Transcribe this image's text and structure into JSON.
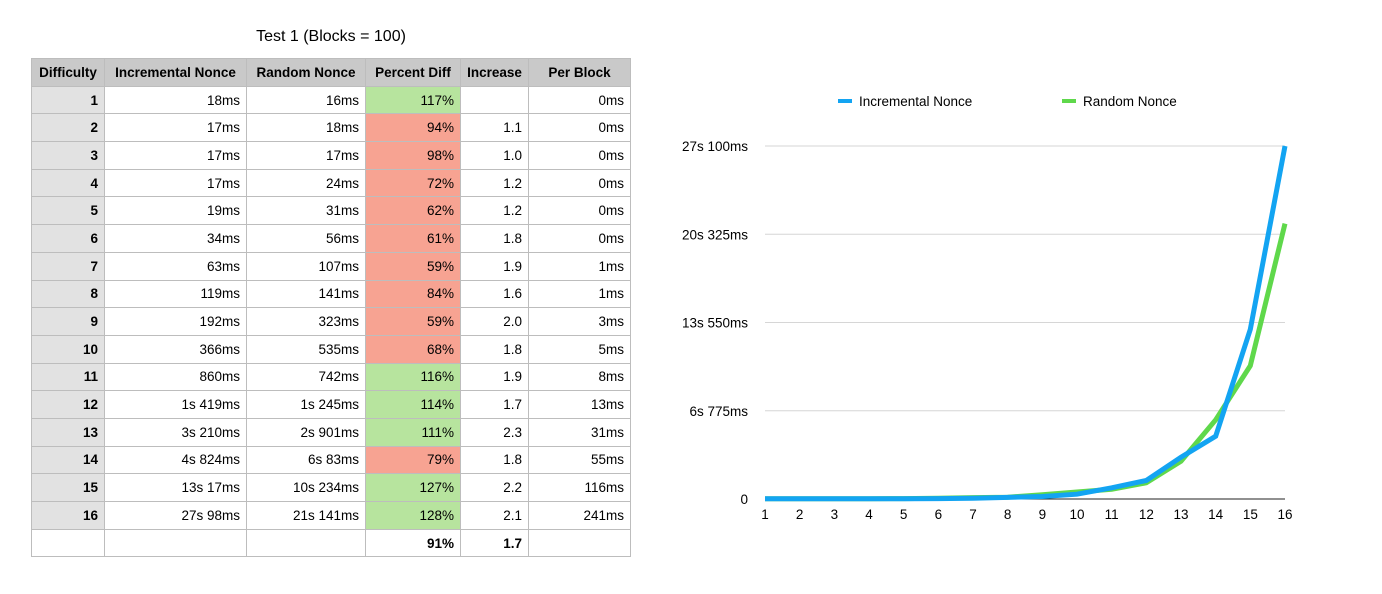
{
  "table": {
    "title": "Test 1 (Blocks = 100)",
    "headers": [
      "Difficulty",
      "Incremental Nonce",
      "Random Nonce",
      "Percent Diff",
      "Increase",
      "Per Block"
    ],
    "rows": [
      {
        "difficulty": "1",
        "incremental": "18ms",
        "random": "16ms",
        "percent": "117%",
        "status": "good",
        "increase": "",
        "per_block": "0ms"
      },
      {
        "difficulty": "2",
        "incremental": "17ms",
        "random": "18ms",
        "percent": "94%",
        "status": "bad",
        "increase": "1.1",
        "per_block": "0ms"
      },
      {
        "difficulty": "3",
        "incremental": "17ms",
        "random": "17ms",
        "percent": "98%",
        "status": "bad",
        "increase": "1.0",
        "per_block": "0ms"
      },
      {
        "difficulty": "4",
        "incremental": "17ms",
        "random": "24ms",
        "percent": "72%",
        "status": "bad",
        "increase": "1.2",
        "per_block": "0ms"
      },
      {
        "difficulty": "5",
        "incremental": "19ms",
        "random": "31ms",
        "percent": "62%",
        "status": "bad",
        "increase": "1.2",
        "per_block": "0ms"
      },
      {
        "difficulty": "6",
        "incremental": "34ms",
        "random": "56ms",
        "percent": "61%",
        "status": "bad",
        "increase": "1.8",
        "per_block": "0ms"
      },
      {
        "difficulty": "7",
        "incremental": "63ms",
        "random": "107ms",
        "percent": "59%",
        "status": "bad",
        "increase": "1.9",
        "per_block": "1ms"
      },
      {
        "difficulty": "8",
        "incremental": "119ms",
        "random": "141ms",
        "percent": "84%",
        "status": "bad",
        "increase": "1.6",
        "per_block": "1ms"
      },
      {
        "difficulty": "9",
        "incremental": "192ms",
        "random": "323ms",
        "percent": "59%",
        "status": "bad",
        "increase": "2.0",
        "per_block": "3ms"
      },
      {
        "difficulty": "10",
        "incremental": "366ms",
        "random": "535ms",
        "percent": "68%",
        "status": "bad",
        "increase": "1.8",
        "per_block": "5ms"
      },
      {
        "difficulty": "11",
        "incremental": "860ms",
        "random": "742ms",
        "percent": "116%",
        "status": "good",
        "increase": "1.9",
        "per_block": "8ms"
      },
      {
        "difficulty": "12",
        "incremental": "1s 419ms",
        "random": "1s 245ms",
        "percent": "114%",
        "status": "good",
        "increase": "1.7",
        "per_block": "13ms"
      },
      {
        "difficulty": "13",
        "incremental": "3s 210ms",
        "random": "2s 901ms",
        "percent": "111%",
        "status": "good",
        "increase": "2.3",
        "per_block": "31ms"
      },
      {
        "difficulty": "14",
        "incremental": "4s 824ms",
        "random": "6s 83ms",
        "percent": "79%",
        "status": "bad",
        "increase": "1.8",
        "per_block": "55ms"
      },
      {
        "difficulty": "15",
        "incremental": "13s 17ms",
        "random": "10s 234ms",
        "percent": "127%",
        "status": "good",
        "increase": "2.2",
        "per_block": "116ms"
      },
      {
        "difficulty": "16",
        "incremental": "27s 98ms",
        "random": "21s 141ms",
        "percent": "128%",
        "status": "good",
        "increase": "2.1",
        "per_block": "241ms"
      }
    ],
    "totals": {
      "percent": "91%",
      "increase": "1.7"
    },
    "colors": {
      "good": "#b7e49e",
      "bad": "#f7a392"
    }
  },
  "chart_data": {
    "type": "line",
    "x": [
      1,
      2,
      3,
      4,
      5,
      6,
      7,
      8,
      9,
      10,
      11,
      12,
      13,
      14,
      15,
      16
    ],
    "series": [
      {
        "name": "Incremental Nonce",
        "color": "#13a4f2",
        "values": [
          18,
          17,
          17,
          17,
          19,
          34,
          63,
          119,
          192,
          366,
          860,
          1419,
          3210,
          4824,
          13017,
          27098
        ]
      },
      {
        "name": "Random Nonce",
        "color": "#5fd84b",
        "values": [
          16,
          18,
          17,
          24,
          31,
          56,
          107,
          141,
          323,
          535,
          742,
          1245,
          2901,
          6083,
          10234,
          21141
        ]
      }
    ],
    "y_ticks": [
      {
        "value": 0,
        "label": "0"
      },
      {
        "value": 6775,
        "label": "6s 775ms"
      },
      {
        "value": 13550,
        "label": "13s 550ms"
      },
      {
        "value": 20325,
        "label": "20s 325ms"
      },
      {
        "value": 27100,
        "label": "27s 100ms"
      }
    ],
    "ylim": [
      0,
      27100
    ],
    "grid": true,
    "legend_position": "top"
  }
}
